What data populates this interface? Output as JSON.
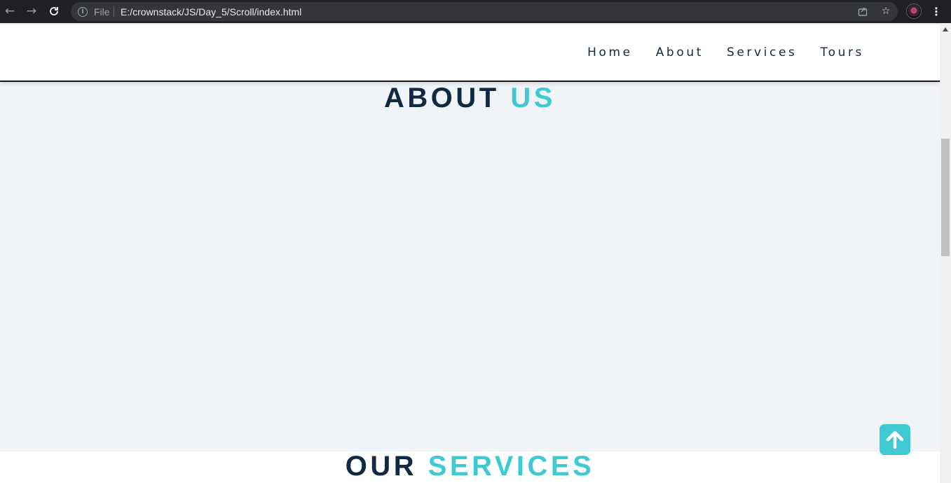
{
  "browser": {
    "back_icon": "arrow-left-icon",
    "forward_icon": "arrow-right-icon",
    "reload_icon": "reload-icon",
    "scheme_label": "File",
    "url": "E:/crownstack/JS/Day_5/Scroll/index.html",
    "share_icon": "share-icon",
    "bookmark_icon": "star-icon",
    "menu_icon": "more-vert-icon"
  },
  "nav": {
    "links": [
      "Home",
      "About",
      "Services",
      "Tours"
    ]
  },
  "about": {
    "title_part1": "ABOUT",
    "title_part2": "US"
  },
  "services": {
    "title_part1": "OUR",
    "title_part2": "SERVICES"
  },
  "scroll_top": {
    "icon": "arrow-up-icon"
  },
  "colors": {
    "primary": "#102a43",
    "accent": "#3fcad3",
    "section_bg": "#f0f4f7",
    "browser_bg": "#202124"
  }
}
